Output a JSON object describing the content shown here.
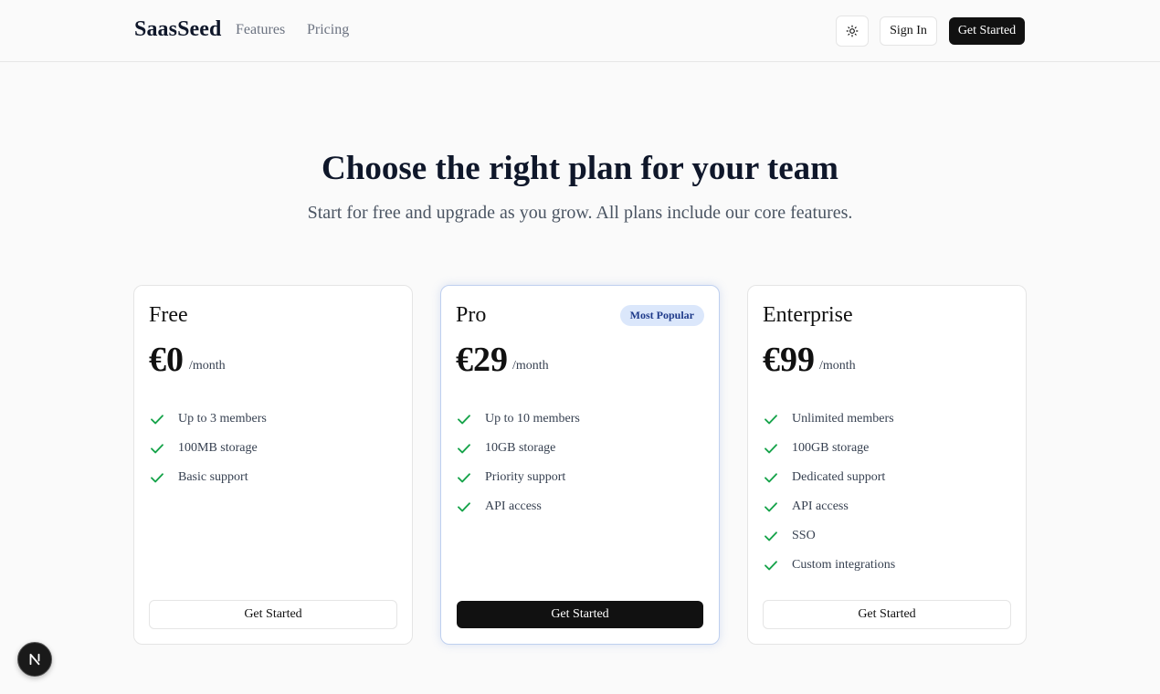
{
  "header": {
    "brand": "SaasSeed",
    "nav": [
      {
        "label": "Features"
      },
      {
        "label": "Pricing"
      }
    ],
    "theme_toggle_icon": "sun-icon",
    "sign_in_label": "Sign In",
    "get_started_label": "Get Started"
  },
  "hero": {
    "title": "Choose the right plan for your team",
    "subtitle": "Start for free and upgrade as you grow. All plans include our core features."
  },
  "plans": [
    {
      "name": "Free",
      "price": "€0",
      "period": "/month",
      "features": [
        "Up to 3 members",
        "100MB storage",
        "Basic support"
      ],
      "button_label": "Get Started"
    },
    {
      "name": "Pro",
      "badge": "Most Popular",
      "price": "€29",
      "period": "/month",
      "features": [
        "Up to 10 members",
        "10GB storage",
        "Priority support",
        "API access"
      ],
      "button_label": "Get Started"
    },
    {
      "name": "Enterprise",
      "price": "€99",
      "period": "/month",
      "features": [
        "Unlimited members",
        "100GB storage",
        "Dedicated support",
        "API access",
        "SSO",
        "Custom integrations"
      ],
      "button_label": "Get Started"
    }
  ],
  "colors": {
    "primary": "#111111",
    "check": "#16a34a",
    "badge_bg": "#dbe7fb",
    "badge_text": "#1e3a8a",
    "page_bg": "#fafafa"
  },
  "floating_logo_icon": "n-logo-icon"
}
